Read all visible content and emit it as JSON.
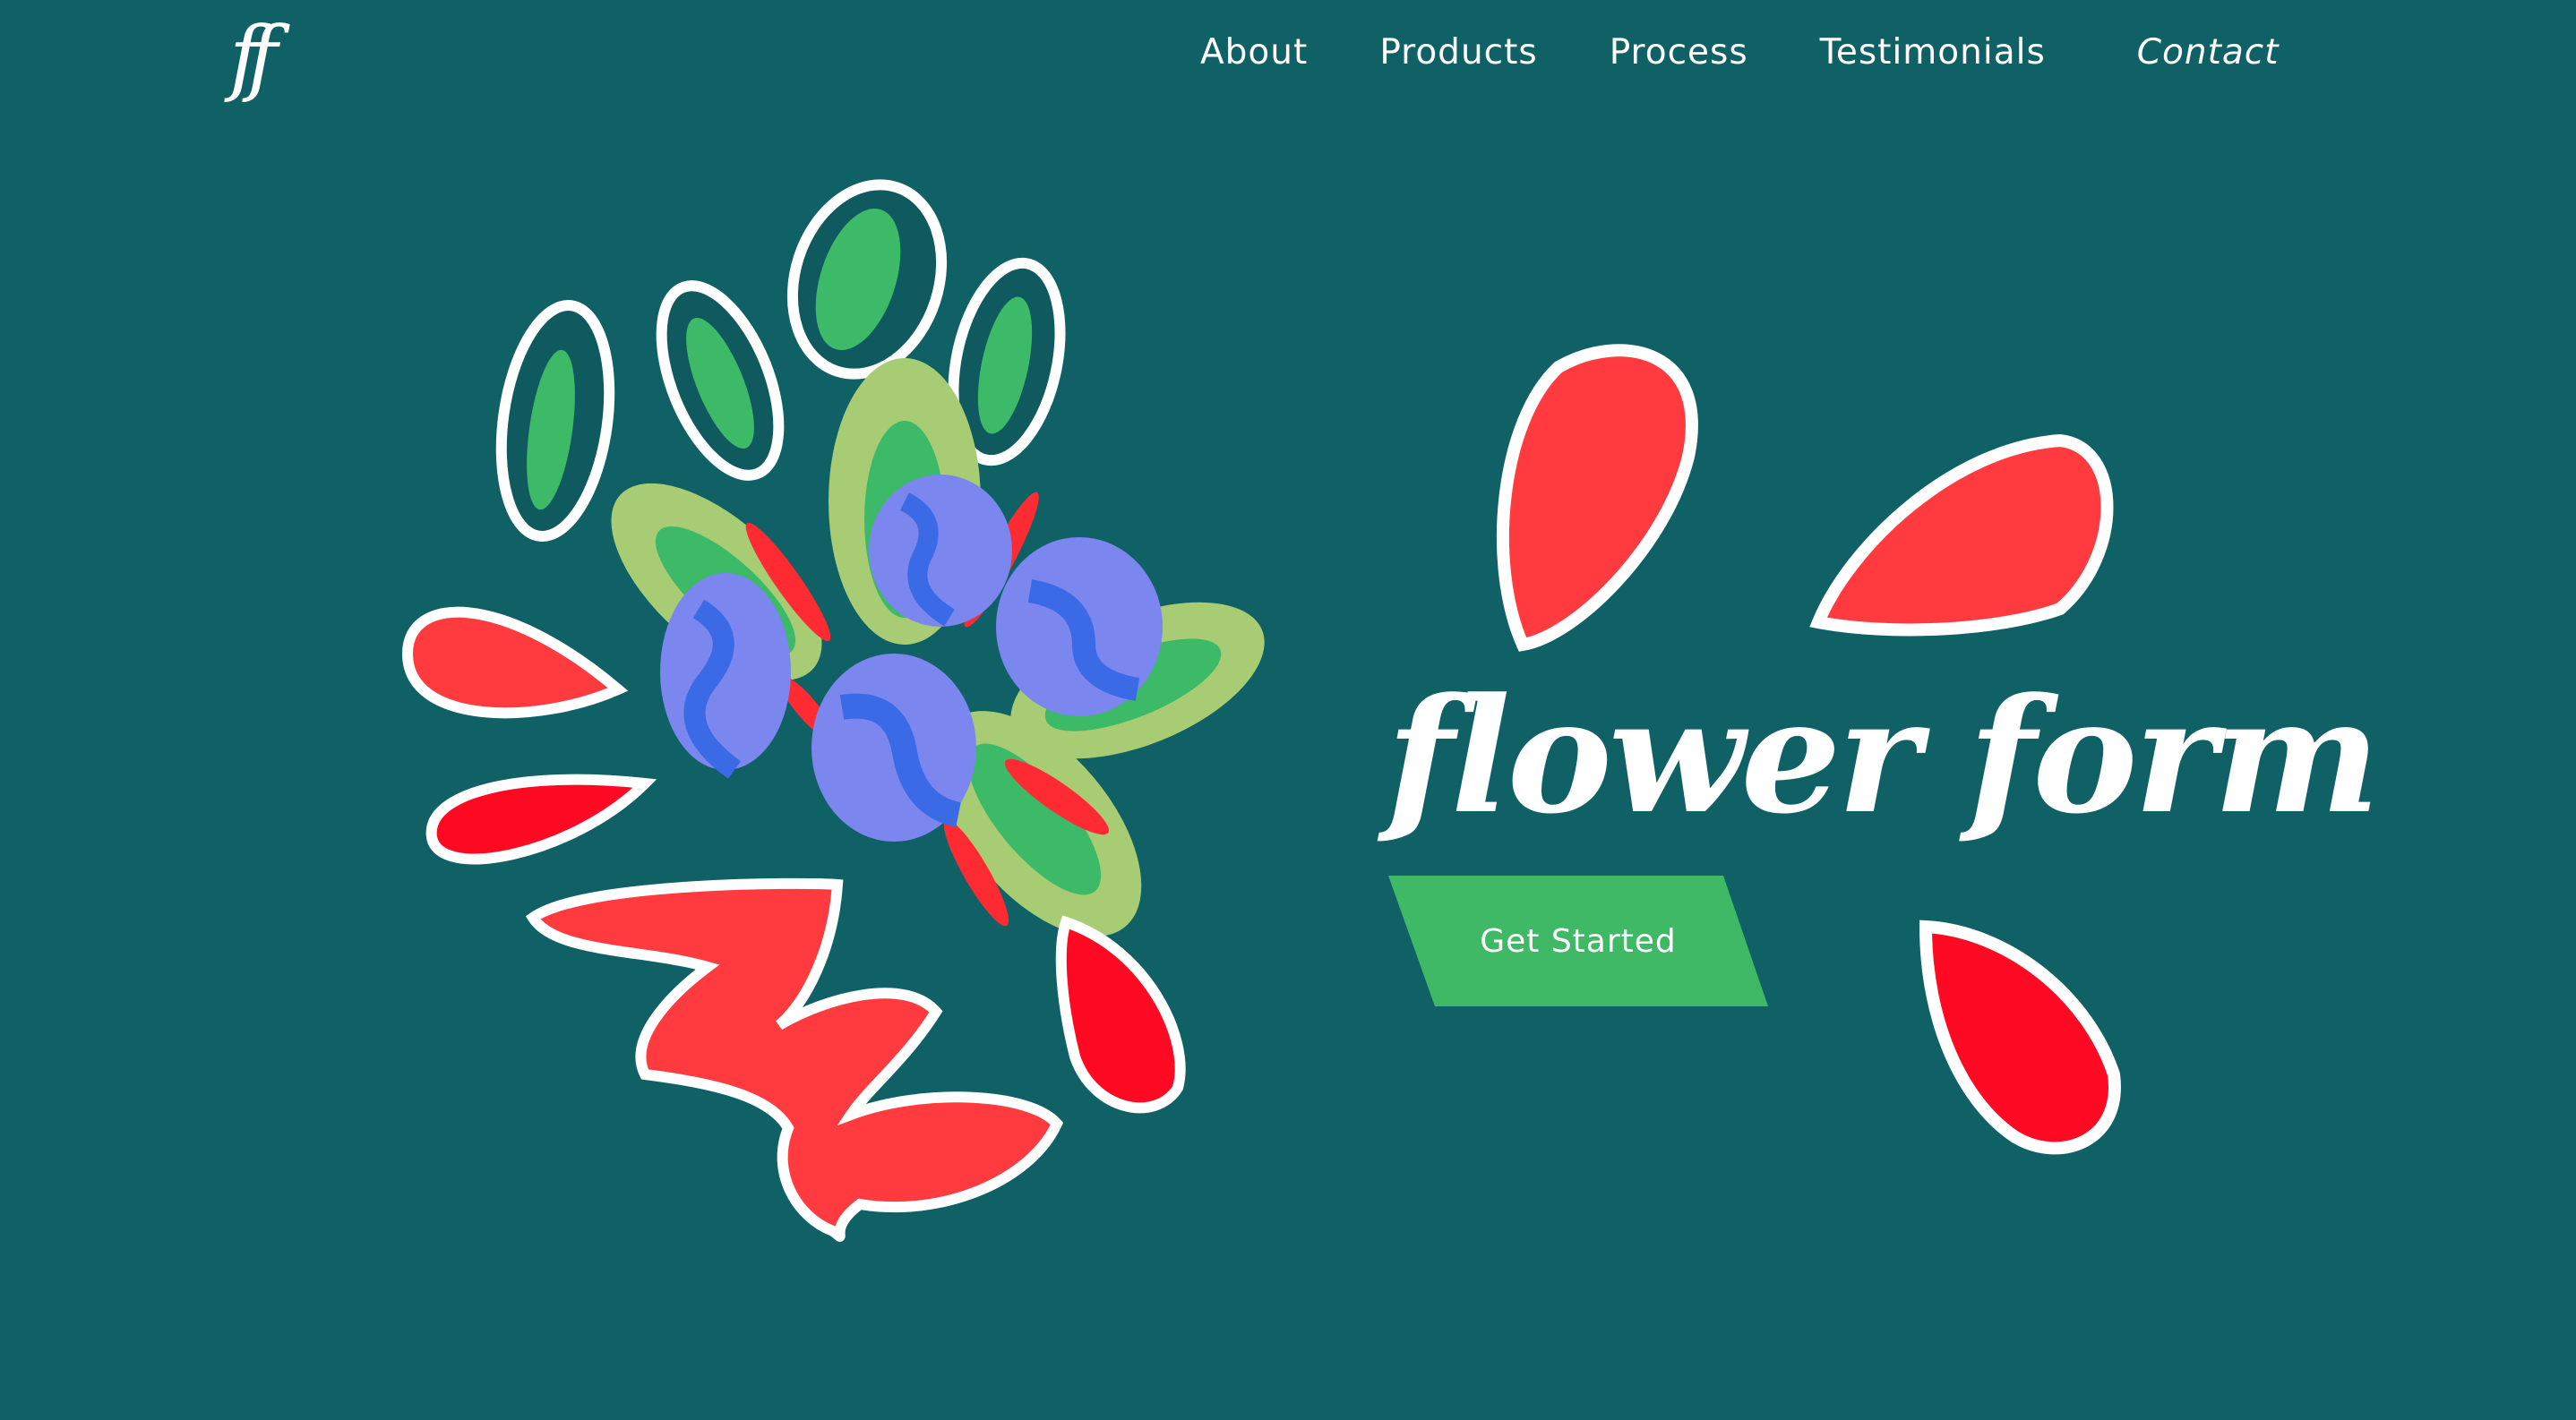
{
  "colors": {
    "background": "#0f6166",
    "button_green": "#3fb965",
    "petal_red": "#ff3b40",
    "petal_red_dark": "#ff0022",
    "leaf_light": "#a8cc74",
    "leaf_green": "#3dba68",
    "berry_blue": "#7b86ee",
    "berry_dark": "#3a6ae6",
    "text": "#ffffff"
  },
  "header": {
    "logo": "ff",
    "nav": {
      "about": "About",
      "products": "Products",
      "process": "Process",
      "testimonials": "Testimonials",
      "contact": "Contact"
    }
  },
  "hero": {
    "title": "flower form",
    "cta_label": "Get Started"
  }
}
